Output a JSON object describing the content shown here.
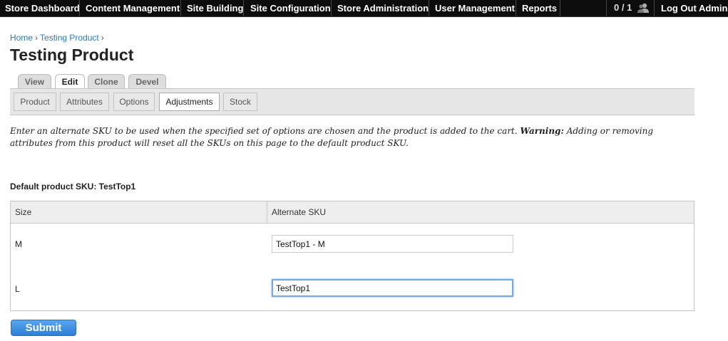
{
  "toolbar": {
    "items": [
      "Store Dashboard",
      "Content Management",
      "Site Building",
      "Site Configuration",
      "Store Administration",
      "User Management",
      "Reports"
    ],
    "users_count": "0 / 1",
    "logout": "Log Out Admin"
  },
  "breadcrumb": {
    "home": "Home",
    "sep": "›",
    "product": "Testing Product"
  },
  "page_title": "Testing Product",
  "primary_tabs": [
    "View",
    "Edit",
    "Clone",
    "Devel"
  ],
  "primary_active": "Edit",
  "secondary_tabs": [
    "Product",
    "Attributes",
    "Options",
    "Adjustments",
    "Stock"
  ],
  "secondary_active": "Adjustments",
  "help": {
    "text1": "Enter an alternate SKU to be used when the specified set of options are chosen and the product is added to the cart.",
    "warning_label": "Warning:",
    "text2": "Adding or removing attributes from this product will reset all the SKUs on this page to the default product SKU."
  },
  "default_sku_label": "Default product SKU: TestTop1",
  "table": {
    "headers": [
      "Size",
      "Alternate SKU"
    ],
    "rows": [
      {
        "size": "M",
        "sku": "TestTop1 - M"
      },
      {
        "size": "L",
        "sku": "TestTop1 "
      }
    ]
  },
  "submit_label": "Submit"
}
